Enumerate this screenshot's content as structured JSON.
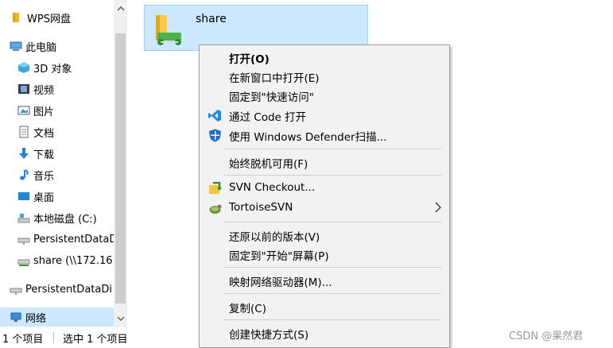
{
  "nav": {
    "items": [
      {
        "label": "WPS网盘",
        "icon": "wps-folder-icon"
      },
      {
        "label": "此电脑",
        "icon": "this-pc-icon"
      },
      {
        "label": "3D 对象",
        "icon": "3d-objects-icon"
      },
      {
        "label": "视频",
        "icon": "video-icon"
      },
      {
        "label": "图片",
        "icon": "pictures-icon"
      },
      {
        "label": "文档",
        "icon": "documents-icon"
      },
      {
        "label": "下载",
        "icon": "download-icon"
      },
      {
        "label": "音乐",
        "icon": "music-icon"
      },
      {
        "label": "桌面",
        "icon": "desktop-icon"
      },
      {
        "label": "本地磁盘 (C:)",
        "icon": "local-disk-icon"
      },
      {
        "label": "PersistentDataD",
        "icon": "network-drive-icon"
      },
      {
        "label": "share (\\\\172.16",
        "icon": "network-share-icon"
      },
      {
        "label": "PersistentDataDi",
        "icon": "network-drive-icon"
      },
      {
        "label": "网络",
        "icon": "network-icon"
      }
    ]
  },
  "status": {
    "item_count": "1 个项目",
    "selected": "选中 1 个项目"
  },
  "content": {
    "file_name": "share"
  },
  "context_menu": {
    "items": [
      {
        "label": "打开(O)",
        "bold": true
      },
      {
        "label": "在新窗口中打开(E)"
      },
      {
        "label": "固定到\"快速访问\""
      },
      {
        "label": "通过 Code 打开",
        "icon": "vscode-icon"
      },
      {
        "label": "使用 Windows Defender扫描...",
        "icon": "defender-shield-icon"
      },
      {
        "label": "始终脱机可用(F)"
      },
      {
        "label": "SVN Checkout...",
        "icon": "svn-checkout-icon"
      },
      {
        "label": "TortoiseSVN",
        "icon": "tortoisesvn-icon"
      },
      {
        "label": "还原以前的版本(V)"
      },
      {
        "label": "固定到\"开始\"屏幕(P)"
      },
      {
        "label": "映射网络驱动器(M)..."
      },
      {
        "label": "复制(C)"
      },
      {
        "label": "创建快捷方式(S)"
      }
    ]
  },
  "watermark": "CSDN @果然君",
  "colors": {
    "selection": "#cce8ff",
    "menu_bg": "#f2f2f2",
    "folder": "#f7c948",
    "accent_blue": "#1e7fd8"
  }
}
